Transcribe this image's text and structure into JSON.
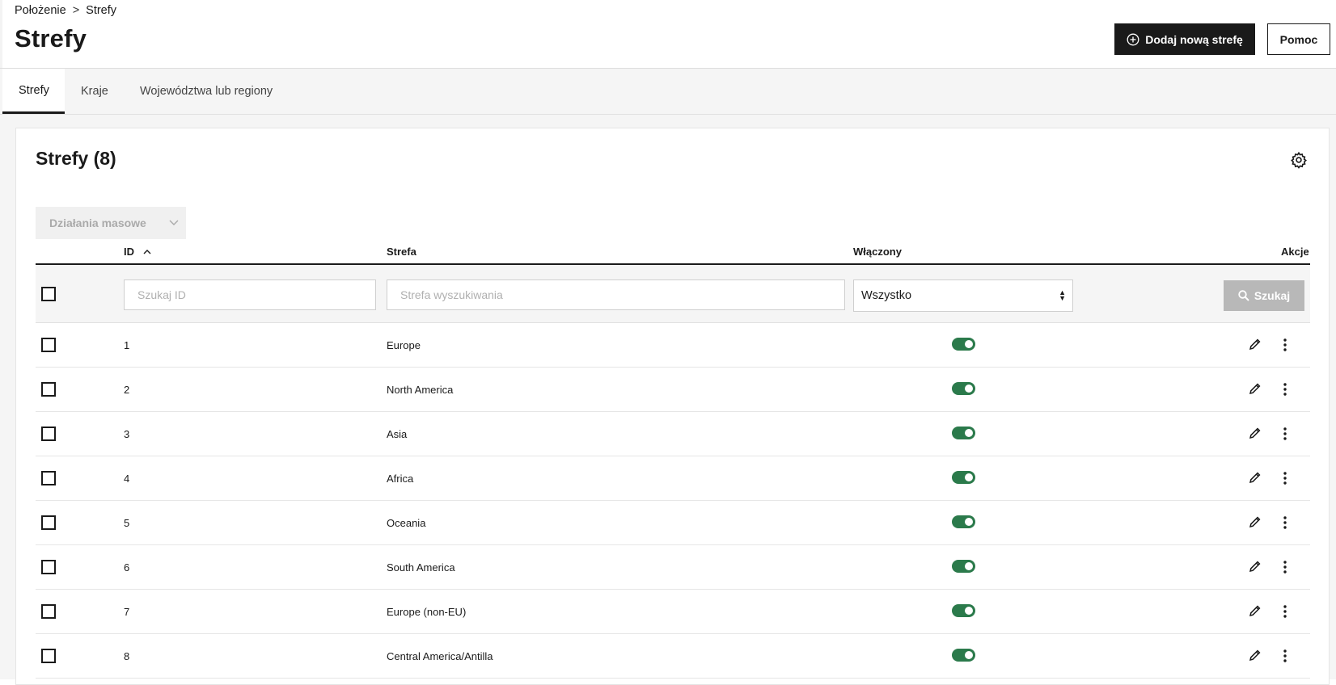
{
  "breadcrumb": {
    "parent": "Położenie",
    "separator": ">",
    "current": "Strefy"
  },
  "page": {
    "title": "Strefy"
  },
  "toolbar": {
    "add_label": "Dodaj nową strefę",
    "help_label": "Pomoc"
  },
  "tabs": [
    {
      "label": "Strefy",
      "active": true
    },
    {
      "label": "Kraje",
      "active": false
    },
    {
      "label": "Województwa lub regiony",
      "active": false
    }
  ],
  "card": {
    "title": "Strefy (8)",
    "bulk_actions_label": "Działania masowe"
  },
  "table": {
    "columns": {
      "id": "ID",
      "zone": "Strefa",
      "enabled": "Włączony",
      "actions": "Akcje"
    },
    "sort": {
      "column": "ID",
      "direction": "asc"
    },
    "filters": {
      "id_placeholder": "Szukaj ID",
      "zone_placeholder": "Strefa wyszukiwania",
      "enabled_value": "Wszystko",
      "search_label": "Szukaj"
    },
    "rows": [
      {
        "id": "1",
        "zone": "Europe",
        "enabled": true
      },
      {
        "id": "2",
        "zone": "North America",
        "enabled": true
      },
      {
        "id": "3",
        "zone": "Asia",
        "enabled": true
      },
      {
        "id": "4",
        "zone": "Africa",
        "enabled": true
      },
      {
        "id": "5",
        "zone": "Oceania",
        "enabled": true
      },
      {
        "id": "6",
        "zone": "South America",
        "enabled": true
      },
      {
        "id": "7",
        "zone": "Europe (non-EU)",
        "enabled": true
      },
      {
        "id": "8",
        "zone": "Central America/Antilla",
        "enabled": true
      }
    ]
  },
  "colors": {
    "primary": "#1a1a1a",
    "toggle_on": "#2b7a4b",
    "disabled_button": "#b8b8b8"
  },
  "icons": [
    "plus-circle-icon",
    "gear-icon",
    "chevron-down-icon",
    "sort-up-icon",
    "search-icon",
    "select-arrows-icon",
    "pencil-icon",
    "more-vertical-icon"
  ]
}
